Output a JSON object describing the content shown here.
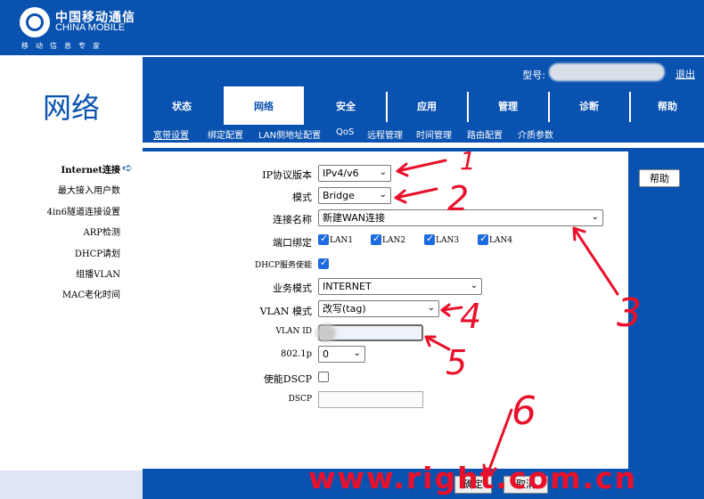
{
  "brand": {
    "name_cn": "中国移动通信",
    "name_en": "CHINA MOBILE",
    "slogan": "移动信息专家"
  },
  "header": {
    "model_label": "型号:",
    "logout": "退出"
  },
  "page_title": "网络",
  "tabs": [
    {
      "label": "状态"
    },
    {
      "label": "网络"
    },
    {
      "label": "安全"
    },
    {
      "label": "应用"
    },
    {
      "label": "管理"
    },
    {
      "label": "诊断"
    },
    {
      "label": "帮助"
    }
  ],
  "active_tab": "网络",
  "subnav": [
    {
      "label": "宽带设置"
    },
    {
      "label": "绑定配置"
    },
    {
      "label": "LAN侧地址配置"
    },
    {
      "label": "QoS"
    },
    {
      "label": "远程管理"
    },
    {
      "label": "时间管理"
    },
    {
      "label": "路由配置"
    },
    {
      "label": "介质参数"
    }
  ],
  "sidebar": [
    {
      "label": "Internet连接"
    },
    {
      "label": "最大接入用户数"
    },
    {
      "label": "4in6隧道连接设置"
    },
    {
      "label": "ARP检测"
    },
    {
      "label": "DHCP请划"
    },
    {
      "label": "组播VLAN"
    },
    {
      "label": "MAC老化时间"
    }
  ],
  "help_button": "帮助",
  "form": {
    "ip_protocol": {
      "label": "IP协议版本",
      "value": "IPv4/v6"
    },
    "mode": {
      "label": "模式",
      "value": "Bridge"
    },
    "connection_name": {
      "label": "连接名称",
      "value": "新建WAN连接"
    },
    "port_binding": {
      "label": "端口绑定",
      "ports": [
        {
          "name": "LAN1",
          "checked": true
        },
        {
          "name": "LAN2",
          "checked": true
        },
        {
          "name": "LAN3",
          "checked": true
        },
        {
          "name": "LAN4",
          "checked": true
        }
      ]
    },
    "dhcp_enable": {
      "label": "DHCP服务使能",
      "checked": true
    },
    "service_mode": {
      "label": "业务模式",
      "value": "INTERNET"
    },
    "vlan_mode": {
      "label": "VLAN 模式",
      "value": "改写(tag)"
    },
    "vlan_id": {
      "label": "VLAN ID",
      "value": ""
    },
    "dot1p": {
      "label": "802.1p",
      "value": "0"
    },
    "enable_dscp": {
      "label": "使能DSCP",
      "checked": false
    },
    "dscp": {
      "label": "DSCP",
      "value": ""
    }
  },
  "bottom": {
    "apply": "确定",
    "cancel": "取消"
  },
  "annotations": {
    "numbers": [
      "1",
      "2",
      "3",
      "4",
      "5",
      "6"
    ],
    "color": "#e8102a"
  },
  "watermark": "www.right.com.cn",
  "colors": {
    "brand_blue": "#0a52b0",
    "checkbox_blue": "#1e6be0",
    "annotation_red": "#e8102a"
  }
}
